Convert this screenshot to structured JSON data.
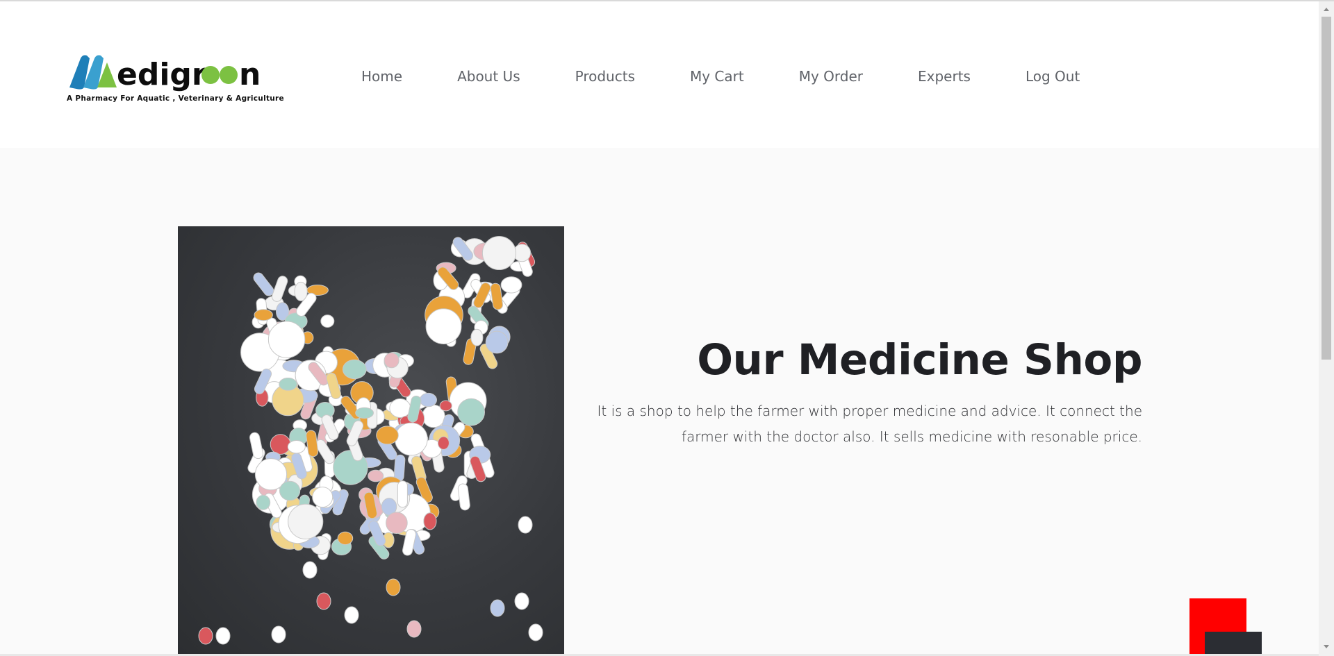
{
  "brand": {
    "name": "Medigreen",
    "tagline": "A Pharmacy For Aquatic , Veterinary & Agriculture",
    "colors": {
      "blue": "#1f7fb8",
      "green": "#7cc142",
      "dark": "#0d0d0d"
    }
  },
  "nav": {
    "items": [
      "Home",
      "About Us",
      "Products",
      "My Cart",
      "My Order",
      "Experts",
      "Log Out"
    ]
  },
  "hero": {
    "title": "Our Medicine Shop",
    "description": "It is a shop to help the farmer with proper medicine and advice. It connect the farmer with the doctor also. It sells medicine with resonable price.",
    "image_icon": "pills-chicken-image"
  },
  "decor": {
    "red": "#ff0000",
    "dark": "#2b2d33"
  }
}
